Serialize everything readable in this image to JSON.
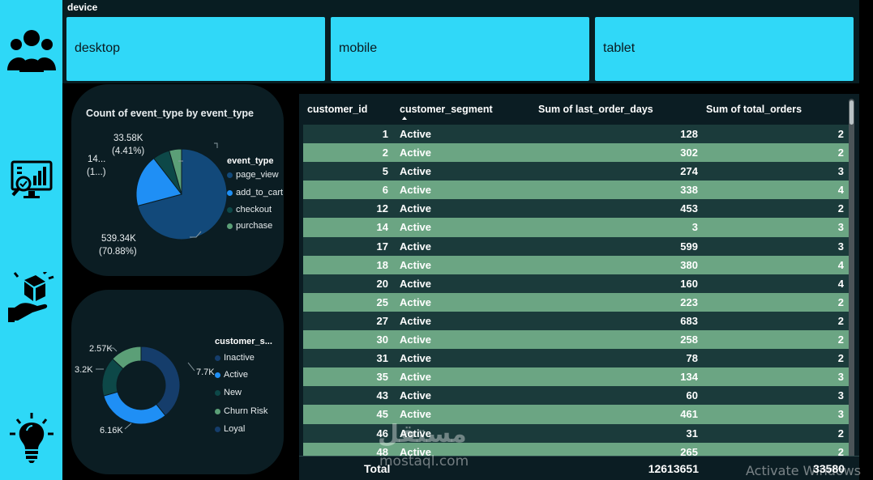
{
  "sidebar": {
    "items": [
      {
        "icon": "users-icon"
      },
      {
        "icon": "analytics-monitor-icon"
      },
      {
        "icon": "product-hand-icon"
      },
      {
        "icon": "lightbulb-icon"
      }
    ]
  },
  "slicer": {
    "title": "device",
    "options": [
      "desktop",
      "mobile",
      "tablet"
    ]
  },
  "pie_chart": {
    "title": "Count of event_type by event_type",
    "legend_title": "event_type",
    "labels": {
      "purchase": [
        "33.58K",
        "(4.41%)"
      ],
      "add_to_cart": [
        "14...",
        "(1...)"
      ],
      "page_view": [
        "539.34K",
        "(70.88%)"
      ]
    }
  },
  "donut_chart": {
    "legend_title": "customer_s...",
    "labels": {
      "inactive": "7.7K",
      "active": "6.16K",
      "new": "3.2K",
      "churn_risk": "2.57K"
    }
  },
  "chart_data": [
    {
      "type": "pie",
      "title": "Count of event_type by event_type",
      "legend_title": "event_type",
      "legend_position": "right",
      "categories": [
        "page_view",
        "add_to_cart",
        "checkout",
        "purchase"
      ],
      "values": [
        539340,
        142000,
        46000,
        33580
      ],
      "percents": [
        70.88,
        18.66,
        6.05,
        4.41
      ],
      "colors": [
        "#12497a",
        "#1f8ff5",
        "#0d4848",
        "#5b9f77"
      ]
    },
    {
      "type": "pie",
      "variant": "donut",
      "legend_title": "customer_s...",
      "legend_position": "right",
      "categories": [
        "Inactive",
        "Active",
        "New",
        "Churn Risk",
        "Loyal"
      ],
      "values": [
        7700,
        6160,
        3200,
        2570,
        0
      ],
      "colors": [
        "#153d6b",
        "#1f8ff5",
        "#0d4848",
        "#5b9f77",
        "#153d6b"
      ]
    },
    {
      "type": "table",
      "columns": [
        "customer_id",
        "customer_segment",
        "Sum of last_order_days",
        "Sum of total_orders"
      ],
      "sorted_by": "customer_segment",
      "rows": [
        [
          "1",
          "Active",
          "128",
          "2"
        ],
        [
          "2",
          "Active",
          "302",
          "2"
        ],
        [
          "5",
          "Active",
          "274",
          "3"
        ],
        [
          "6",
          "Active",
          "338",
          "4"
        ],
        [
          "12",
          "Active",
          "453",
          "2"
        ],
        [
          "14",
          "Active",
          "3",
          "3"
        ],
        [
          "17",
          "Active",
          "599",
          "3"
        ],
        [
          "18",
          "Active",
          "380",
          "4"
        ],
        [
          "20",
          "Active",
          "160",
          "4"
        ],
        [
          "25",
          "Active",
          "223",
          "2"
        ],
        [
          "27",
          "Active",
          "683",
          "2"
        ],
        [
          "30",
          "Active",
          "258",
          "2"
        ],
        [
          "31",
          "Active",
          "78",
          "2"
        ],
        [
          "35",
          "Active",
          "134",
          "3"
        ],
        [
          "43",
          "Active",
          "60",
          "3"
        ],
        [
          "45",
          "Active",
          "461",
          "3"
        ],
        [
          "46",
          "Active",
          "31",
          "2"
        ],
        [
          "48",
          "Active",
          "265",
          "2"
        ]
      ],
      "total": {
        "label": "Total",
        "last_order_days": "12613651",
        "total_orders": "33580"
      }
    }
  ],
  "watermark": {
    "arabic": "مستقل",
    "latin": "mostaql.com"
  },
  "os_overlay": {
    "activate": "Activate Windows"
  }
}
